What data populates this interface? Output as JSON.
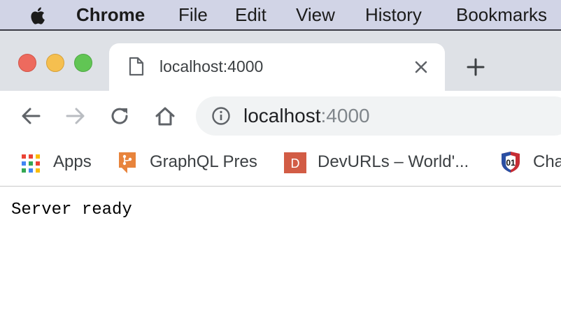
{
  "menubar": {
    "app_name": "Chrome",
    "items": [
      "File",
      "Edit",
      "View",
      "History",
      "Bookmarks"
    ],
    "icon": "apple-icon"
  },
  "tab": {
    "title": "localhost:4000",
    "icon": "page-icon"
  },
  "omnibox": {
    "host": "localhost",
    "port": ":4000",
    "icon": "info-icon"
  },
  "bookmarks": [
    {
      "label": "Apps",
      "icon": "apps-grid-icon"
    },
    {
      "label": "GraphQL Pres",
      "icon": "git-icon"
    },
    {
      "label": "DevURLs – World'...",
      "icon": "devurls-icon",
      "icon_letter": "D"
    },
    {
      "label": "Cha",
      "icon": "badge-icon",
      "icon_text": "01"
    }
  ],
  "content": {
    "text": "Server ready"
  },
  "colors": {
    "menubar_bg": "#d1d4e6",
    "tabstrip_bg": "#dee1e6",
    "omnibox_bg": "#f1f3f4",
    "devurls_red": "#d25c45",
    "git_orange": "#e8843c"
  }
}
